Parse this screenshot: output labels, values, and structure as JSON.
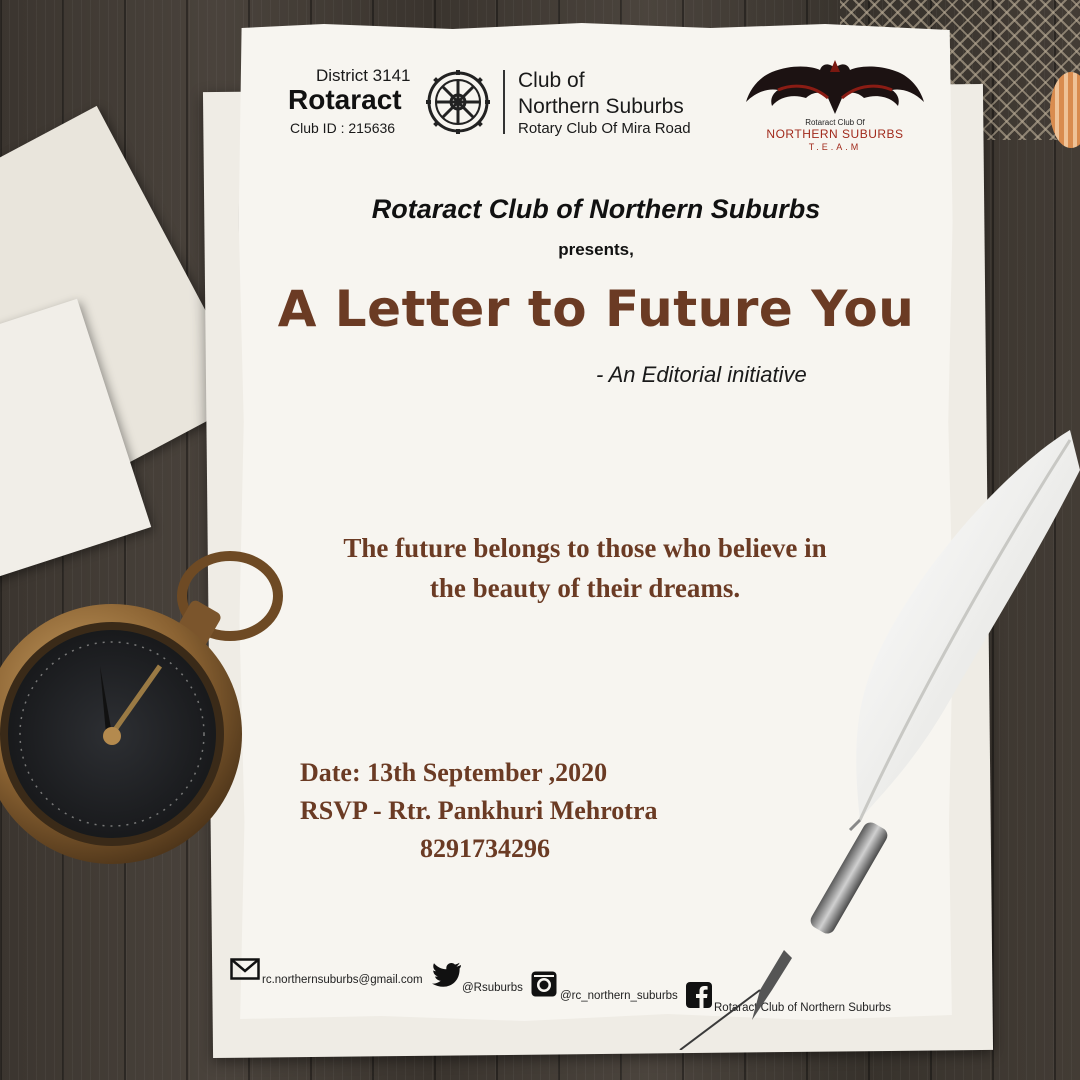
{
  "header": {
    "district": "District 3141",
    "rotaract": "Rotaract",
    "club_id": "Club ID : 215636",
    "club_of": "Club of",
    "club_name": "Northern Suburbs",
    "parent_club": "Rotary Club Of Mira Road",
    "team_logo": {
      "small": "Rotaract Club Of",
      "name": "NORTHERN SUBURBS",
      "sub": "T.E.A.M"
    }
  },
  "org_name": "Rotaract Club of Northern Suburbs",
  "presents": "presents,",
  "title": "A Letter to Future You",
  "subtitle": "- An Editorial initiative",
  "quote_line1": "The future belongs to those who believe in",
  "quote_line2": "the beauty of their dreams.",
  "date": "Date: 13th September ,2020",
  "rsvp": "RSVP - Rtr. Pankhuri Mehrotra",
  "phone": "8291734296",
  "footer": {
    "email": "rc.northernsuburbs@gmail.com",
    "twitter": "@Rsuburbs",
    "instagram": "@rc_northern_suburbs",
    "facebook": "Rotaract Club of Northern Suburbs"
  },
  "colors": {
    "accent_brown": "#6b3b24",
    "team_red": "#a12a1c",
    "paper": "#f7f5f0"
  }
}
